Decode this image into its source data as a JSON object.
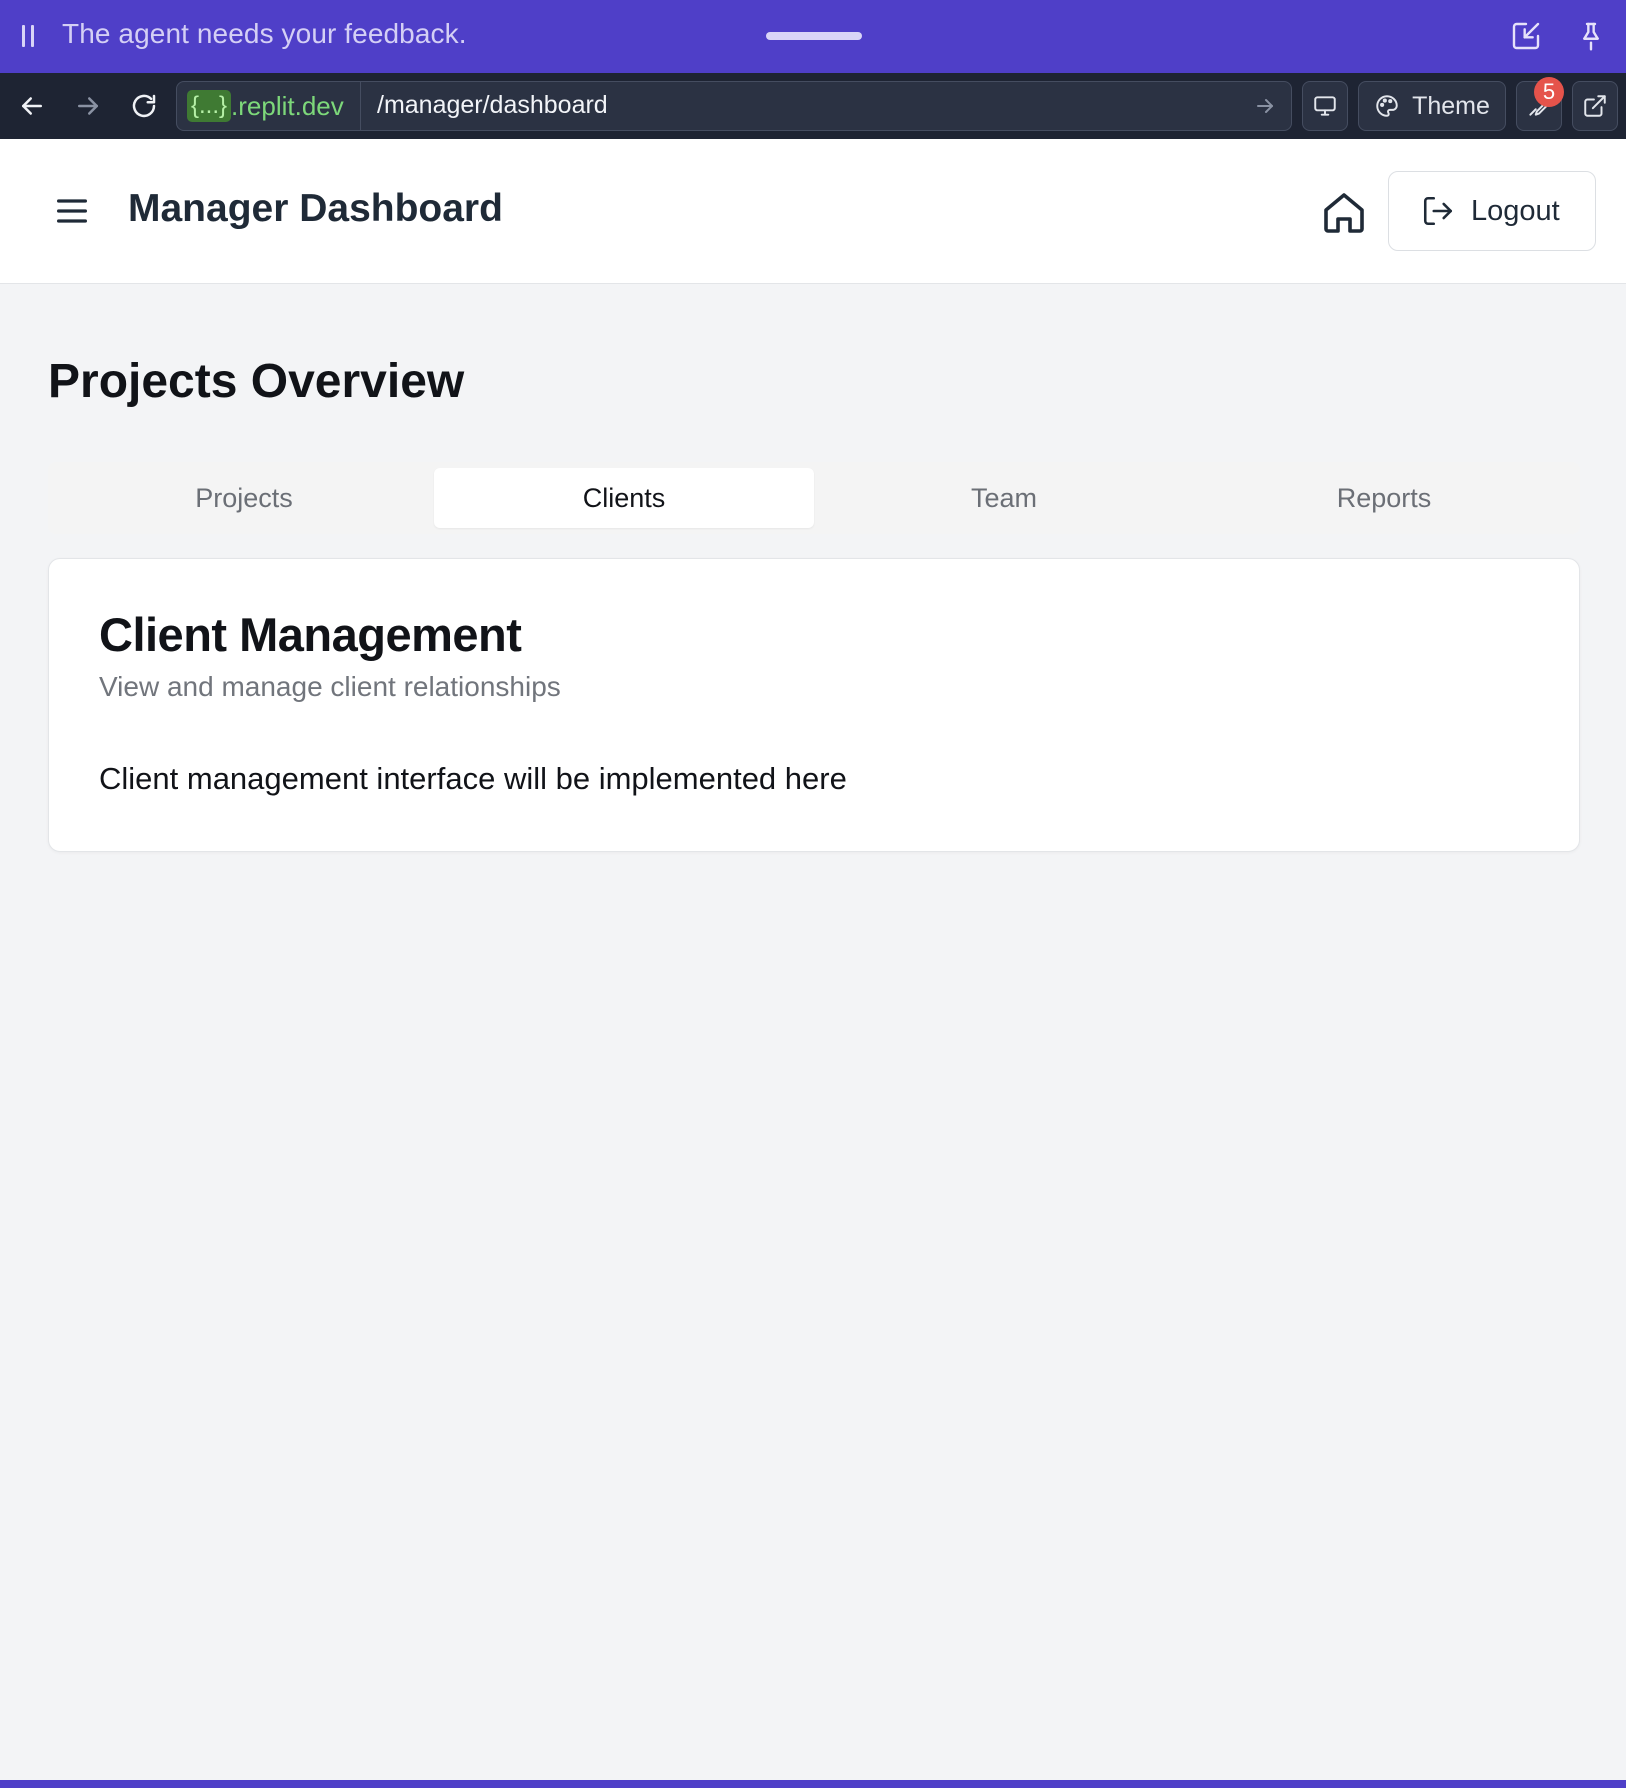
{
  "banner": {
    "message": "The agent needs your feedback."
  },
  "browser": {
    "url_host_braces": "{...}",
    "url_host_domain": ".replit.dev",
    "url_path": "/manager/dashboard",
    "theme_label": "Theme",
    "devtools_badge_count": "5"
  },
  "header": {
    "title": "Manager Dashboard",
    "logout_label": "Logout"
  },
  "main": {
    "page_title": "Projects Overview",
    "tabs": [
      {
        "label": "Projects",
        "active": false
      },
      {
        "label": "Clients",
        "active": true
      },
      {
        "label": "Team",
        "active": false
      },
      {
        "label": "Reports",
        "active": false
      }
    ],
    "card": {
      "title": "Client Management",
      "subtitle": "View and manage client relationships",
      "body": "Client management interface will be implemented here"
    }
  },
  "colors": {
    "banner_bg": "#4f3fc8",
    "browser_bg": "#1e2433",
    "page_bg": "#f3f4f6",
    "badge": "#e5534b",
    "host_green": "#7dd87a"
  },
  "icons": {
    "banner_left": "drag-grip-icon",
    "banner_right": [
      "collapse-window-icon",
      "pin-icon"
    ],
    "browser": [
      "back-arrow-icon",
      "forward-arrow-icon",
      "reload-icon",
      "go-arrow-icon",
      "device-preview-icon",
      "palette-icon",
      "wrench-icon",
      "external-link-icon"
    ],
    "header": [
      "hamburger-menu-icon",
      "home-icon",
      "logout-icon"
    ]
  }
}
